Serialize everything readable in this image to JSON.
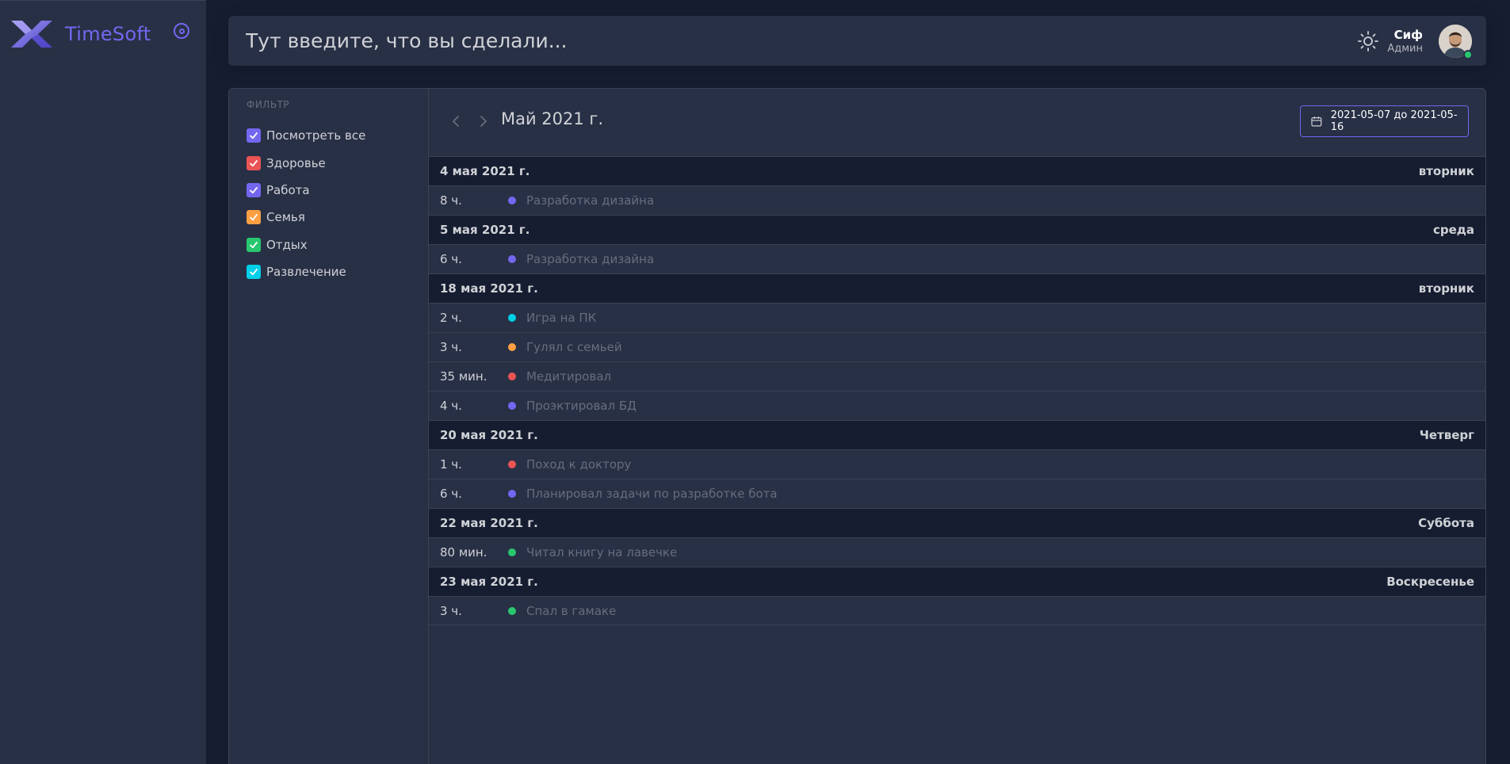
{
  "app": {
    "brand": "TimeSoft"
  },
  "navbar": {
    "placeholder": "Тут введите, что вы сделали...",
    "user_name": "Сиф",
    "user_role": "Админ"
  },
  "filter": {
    "title": "ФИЛЬТР",
    "items": [
      {
        "label": "Посмотреть все",
        "color": "#7367f0",
        "checked": true
      },
      {
        "label": "Здоровье",
        "color": "#ea5455",
        "checked": true
      },
      {
        "label": "Работа",
        "color": "#7367f0",
        "checked": true
      },
      {
        "label": "Семья",
        "color": "#ff9f43",
        "checked": true
      },
      {
        "label": "Отдых",
        "color": "#28c76f",
        "checked": true
      },
      {
        "label": "Развлечение",
        "color": "#00cfe8",
        "checked": true
      }
    ]
  },
  "calendar": {
    "month_title": "Май 2021 г.",
    "date_range": "2021-05-07 до 2021-05-16",
    "days": [
      {
        "date": "4 мая 2021 г.",
        "weekday": "вторник",
        "events": [
          {
            "duration": "8 ч.",
            "title": "Разработка дизайна",
            "color": "#7367f0"
          }
        ]
      },
      {
        "date": "5 мая 2021 г.",
        "weekday": "среда",
        "events": [
          {
            "duration": "6 ч.",
            "title": "Разработка дизайна",
            "color": "#7367f0"
          }
        ]
      },
      {
        "date": "18 мая 2021 г.",
        "weekday": "вторник",
        "events": [
          {
            "duration": "2 ч.",
            "title": "Игра на ПК",
            "color": "#00cfe8"
          },
          {
            "duration": "3 ч.",
            "title": "Гулял с семьей",
            "color": "#ff9f43"
          },
          {
            "duration": "35 мин.",
            "title": "Медитировал",
            "color": "#ea5455"
          },
          {
            "duration": "4 ч.",
            "title": "Проэктировал БД",
            "color": "#7367f0"
          }
        ]
      },
      {
        "date": "20 мая 2021 г.",
        "weekday": "Четверг",
        "events": [
          {
            "duration": "1 ч.",
            "title": "Поход к доктору",
            "color": "#ea5455"
          },
          {
            "duration": "6 ч.",
            "title": "Планировал задачи по разработке бота",
            "color": "#7367f0"
          }
        ]
      },
      {
        "date": "22 мая 2021 г.",
        "weekday": "Суббота",
        "events": [
          {
            "duration": "80 мин.",
            "title": "Читал книгу на лавечке",
            "color": "#28c76f"
          }
        ]
      },
      {
        "date": "23 мая 2021 г.",
        "weekday": "Воскресенье",
        "events": [
          {
            "duration": "3 ч.",
            "title": "Спал в гамаке",
            "color": "#28c76f"
          }
        ]
      }
    ]
  },
  "icons": {
    "logo": "timesoft-logo-icon",
    "collapse": "disc-icon",
    "theme": "sun-icon",
    "prev": "chevron-left-icon",
    "next": "chevron-right-icon",
    "calendar": "calendar-icon",
    "check": "check-icon"
  }
}
